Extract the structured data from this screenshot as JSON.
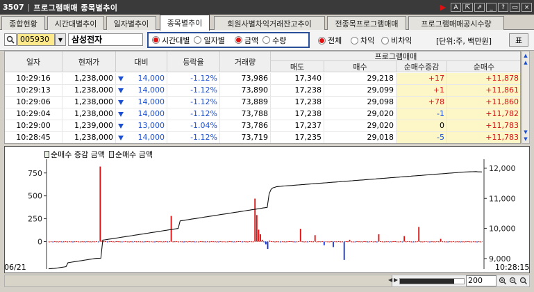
{
  "window": {
    "screen_no": "3507",
    "title": "프로그램매매 종목별추이",
    "buttons": {
      "play": "▶",
      "font": "A",
      "export": "⇱",
      "pin": "⇗",
      "minimize": "_",
      "help": "?",
      "restore": "▭",
      "close": "×"
    }
  },
  "tabs": [
    {
      "label": "종합현황",
      "active": false
    },
    {
      "label": "시간대별추이",
      "active": false
    },
    {
      "label": "일자별추이",
      "active": false
    },
    {
      "label": "종목별추이",
      "active": true
    },
    {
      "label": "회원사별차익거래잔고추이",
      "active": false
    },
    {
      "label": "전종목프로그램매매",
      "active": false
    },
    {
      "label": "프로그램매매공시수량",
      "active": false
    }
  ],
  "toolbar": {
    "stock_code": "005930",
    "stock_name": "삼성전자",
    "period_radio": [
      {
        "label": "시간대별",
        "checked": true
      },
      {
        "label": "일자별",
        "checked": false
      }
    ],
    "unit_radio": [
      {
        "label": "금액",
        "checked": true
      },
      {
        "label": "수량",
        "checked": false
      }
    ],
    "type_radio": [
      {
        "label": "전체",
        "checked": true
      },
      {
        "label": "차익",
        "checked": false
      },
      {
        "label": "비차익",
        "checked": false
      }
    ],
    "unit_text": "[단위:주, 백만원]",
    "table_button": "표"
  },
  "table": {
    "headers": {
      "time": "일자",
      "price": "현재가",
      "change": "대비",
      "rate": "등락율",
      "volume": "거래량",
      "program_group": "프로그램매매",
      "sell": "매도",
      "buy": "매수",
      "net_change": "순매수증감",
      "net": "순매수"
    },
    "rows": [
      {
        "time": "10:29:16",
        "price": "1,238,000",
        "change": "14,000",
        "rate": "-1.12%",
        "volume": "73,986",
        "sell": "17,340",
        "buy": "29,218",
        "net_change": "+17",
        "net": "+11,878"
      },
      {
        "time": "10:29:13",
        "price": "1,238,000",
        "change": "14,000",
        "rate": "-1.12%",
        "volume": "73,890",
        "sell": "17,238",
        "buy": "29,099",
        "net_change": "+1",
        "net": "+11,861"
      },
      {
        "time": "10:29:06",
        "price": "1,238,000",
        "change": "14,000",
        "rate": "-1.12%",
        "volume": "73,889",
        "sell": "17,238",
        "buy": "29,098",
        "net_change": "+78",
        "net": "+11,860"
      },
      {
        "time": "10:29:04",
        "price": "1,238,000",
        "change": "14,000",
        "rate": "-1.12%",
        "volume": "73,788",
        "sell": "17,238",
        "buy": "29,020",
        "net_change": "-1",
        "net": "+11,782"
      },
      {
        "time": "10:29:00",
        "price": "1,239,000",
        "change": "13,000",
        "rate": "-1.04%",
        "volume": "73,786",
        "sell": "17,237",
        "buy": "29,020",
        "net_change": "0",
        "net": "+11,783"
      },
      {
        "time": "10:28:45",
        "price": "1,238,000",
        "change": "14,000",
        "rate": "-1.12%",
        "volume": "73,719",
        "sell": "17,235",
        "buy": "29,018",
        "net_change": "-5",
        "net": "+11,783"
      }
    ]
  },
  "chart_data": {
    "type": "bar",
    "legend": [
      "순매수 증감 금액",
      "순매수 금액"
    ],
    "left_ticks": [
      "750",
      "500",
      "250",
      "0"
    ],
    "right_ticks": [
      "12,000",
      "11,000",
      "10,000",
      "9,000"
    ],
    "left_range": [
      -300,
      900
    ],
    "right_range": [
      8650,
      12300
    ],
    "start_label": "06/21",
    "end_label": "10:28:15",
    "net_buy_change": [
      0,
      2,
      -1,
      3,
      1,
      0,
      2,
      -2,
      1,
      3,
      0,
      2,
      1,
      -1,
      2,
      3,
      1,
      0,
      2,
      1,
      -3,
      2,
      1,
      0,
      2,
      1,
      3,
      -2,
      820,
      10,
      2,
      3,
      -1,
      2,
      4,
      1,
      0,
      3,
      2,
      1,
      -1,
      2,
      3,
      1,
      0,
      2,
      -2,
      3,
      1,
      2,
      1,
      0,
      -1,
      2,
      3,
      1,
      2,
      0,
      -2,
      3,
      1,
      2,
      0,
      1,
      3,
      -1,
      2,
      280,
      1,
      2,
      3,
      0,
      2,
      1,
      -1,
      2,
      0,
      3,
      1,
      2,
      -2,
      1,
      0,
      3,
      2,
      1,
      -1,
      2,
      0,
      3,
      2,
      1,
      0,
      -2,
      3,
      1,
      2,
      0,
      1,
      3,
      2,
      -1,
      0,
      2,
      4,
      3,
      -1,
      2,
      1,
      0,
      3,
      2,
      1,
      470,
      290,
      130,
      80,
      20,
      -5,
      -30,
      -80,
      10,
      3,
      2,
      0,
      2,
      1,
      -3,
      2,
      1,
      0,
      2,
      4,
      3,
      1,
      -2,
      1,
      3,
      140,
      2,
      0,
      1,
      -1,
      3,
      2,
      1,
      70,
      0,
      2,
      1,
      3,
      -40,
      2,
      1,
      0,
      3,
      -60,
      2,
      1,
      4,
      0,
      1,
      -200,
      3,
      2,
      20,
      1,
      0,
      -2,
      3,
      2,
      1,
      0,
      4,
      2,
      -1,
      1,
      3,
      0,
      2,
      -1,
      80,
      3,
      1,
      0,
      2,
      2,
      -2,
      1,
      3,
      4,
      1,
      0,
      2,
      -1,
      60,
      1,
      3,
      2,
      0,
      -3,
      1,
      2,
      160,
      1,
      0,
      2,
      3,
      1,
      -2,
      2,
      1,
      0,
      3,
      1,
      30,
      2,
      1,
      0,
      -1,
      2,
      1,
      3,
      0,
      2,
      1,
      -2,
      1,
      0,
      2,
      3,
      1,
      0,
      2,
      1,
      -1,
      2,
      0
    ],
    "net_buy_line": [
      8660,
      8665,
      8668,
      8670,
      8680,
      8690,
      8700,
      8710,
      8720,
      8730,
      8860,
      8870,
      8880,
      8890,
      8900,
      8910,
      8920,
      8930,
      8940,
      8950,
      8960,
      8970,
      8980,
      8990,
      9000,
      9005,
      9008,
      9010,
      9610,
      9620,
      9630,
      9640,
      9650,
      9660,
      9670,
      9680,
      9690,
      9700,
      9710,
      9720,
      9730,
      9740,
      9750,
      9760,
      9770,
      9780,
      9790,
      9800,
      9810,
      9820,
      9830,
      9840,
      9850,
      9860,
      9870,
      9880,
      9890,
      9900,
      9910,
      9920,
      9930,
      9940,
      9950,
      9960,
      9970,
      9980,
      9990,
      10000,
      10250,
      10260,
      10270,
      10280,
      10290,
      10300,
      10310,
      10320,
      10330,
      10340,
      10350,
      10360,
      10370,
      10380,
      10390,
      10400,
      10410,
      10420,
      10430,
      10440,
      10450,
      10460,
      10470,
      10480,
      10490,
      10500,
      10510,
      10520,
      10530,
      10540,
      10550,
      10560,
      10570,
      10580,
      10590,
      10600,
      10610,
      10620,
      10630,
      10640,
      10650,
      10660,
      10670,
      10680,
      10690,
      10700,
      11150,
      11300,
      11350,
      11370,
      11390,
      11395,
      11400,
      11405,
      11410,
      11415,
      11420,
      11425,
      11430,
      11435,
      11440,
      11445,
      11450,
      11455,
      11460,
      11465,
      11470,
      11475,
      11480,
      11485,
      11490,
      11495,
      11500,
      11505,
      11510,
      11515,
      11520,
      11525,
      11530,
      11535,
      11540,
      11545,
      11550,
      11555,
      11560,
      11565,
      11570,
      11575,
      11580,
      11585,
      11590,
      11595,
      11600,
      11605,
      11610,
      11615,
      11620,
      11625,
      11630,
      11635,
      11640,
      11645,
      11650,
      11655,
      11660,
      11665,
      11670,
      11675,
      11680,
      11685,
      11690,
      11695,
      11700,
      11705,
      11710,
      11715,
      11720,
      11725,
      11730,
      11735,
      11740,
      11745,
      11750,
      11755,
      11760,
      11765,
      11770,
      11775,
      11780,
      11785,
      11790,
      11795,
      11800,
      11805,
      11810,
      11815,
      11820,
      11825,
      11830,
      11835,
      11840,
      11845,
      11850,
      11855,
      11860,
      11865,
      11870,
      11875,
      11878,
      11880,
      11882,
      11884,
      11886,
      11888,
      11880,
      11879,
      11878
    ]
  },
  "bottom": {
    "zoom": "200",
    "zoom_level": 0.85
  }
}
